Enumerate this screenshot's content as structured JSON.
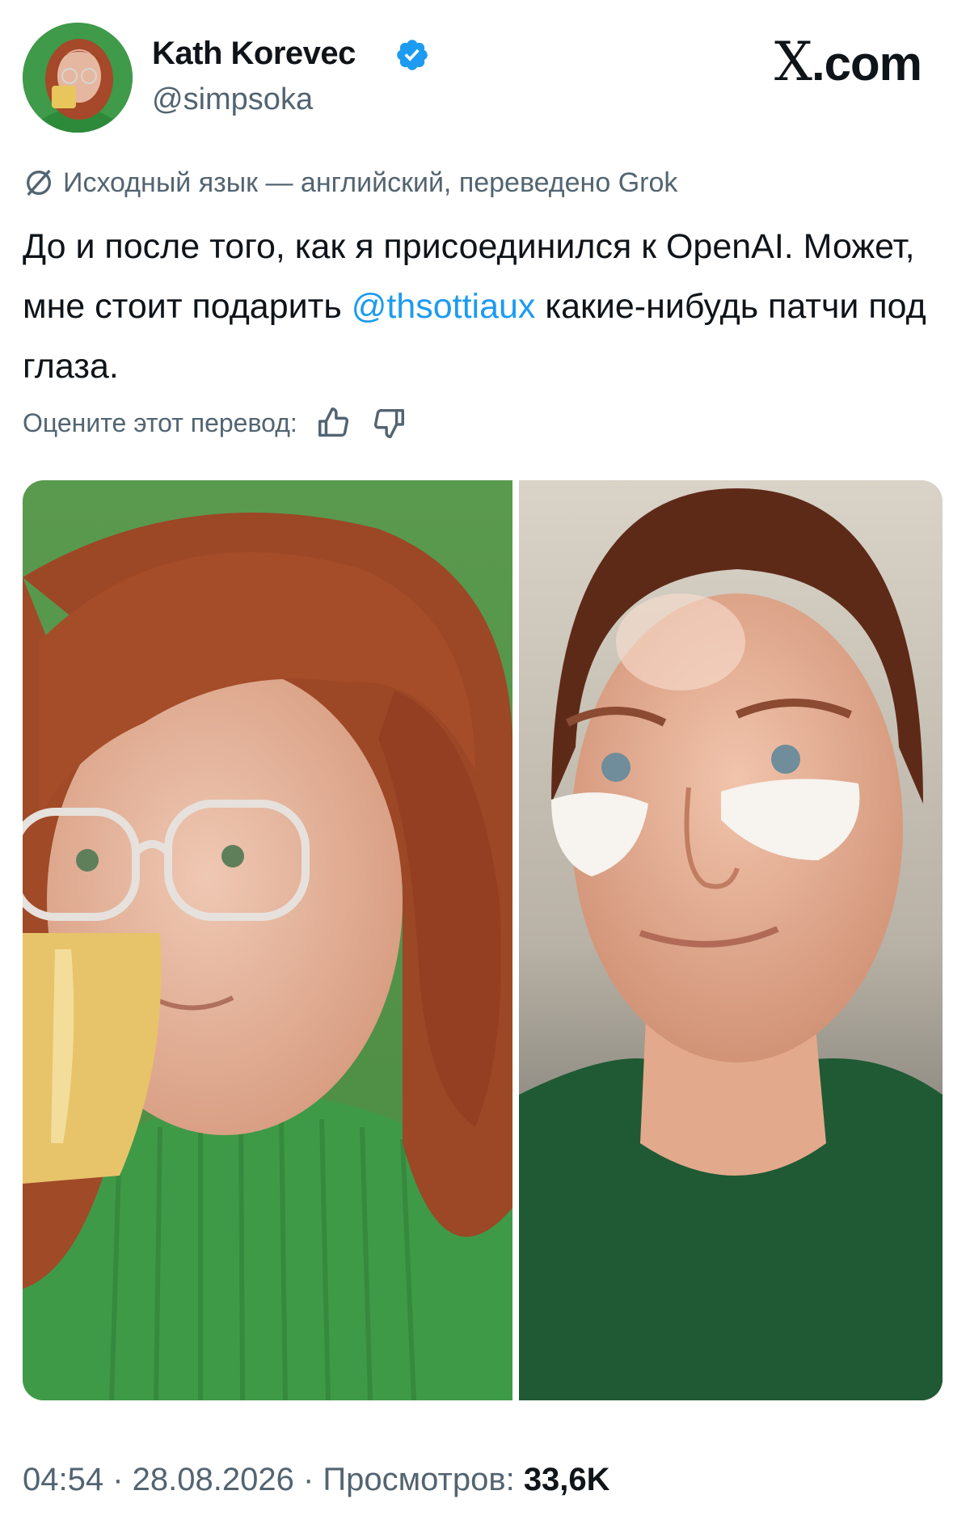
{
  "author": {
    "name": "Kath Korevec",
    "handle": "@simpsoka",
    "verified": true,
    "avatar_icon": "avatar-woman-with-mug"
  },
  "site": {
    "logo_text": "X",
    "logo_suffix": ".com"
  },
  "translation": {
    "icon": "globe-slash-icon",
    "note": "Исходный язык — английский, переведено Grok"
  },
  "tweet": {
    "text_part1": "До и после того, как я присоединился к OpenAI. Может, мне стоит подарить ",
    "mention": "@thsottiaux",
    "text_part2": " какие-нибудь патчи под глаза."
  },
  "rate": {
    "label": "Оцените этот перевод:",
    "like_icon": "thumbs-up-icon",
    "dislike_icon": "thumbs-down-icon"
  },
  "media": {
    "left_photo": "before-photo",
    "right_photo": "after-photo"
  },
  "meta": {
    "time": "04:54",
    "separator": " · ",
    "date": "28.08.2026",
    "views_label": "Просмотров: ",
    "views_count": "33,6K"
  },
  "colors": {
    "text": "#0f1419",
    "secondary": "#536471",
    "link": "#1d9bf0",
    "verified": "#1d9bf0"
  }
}
